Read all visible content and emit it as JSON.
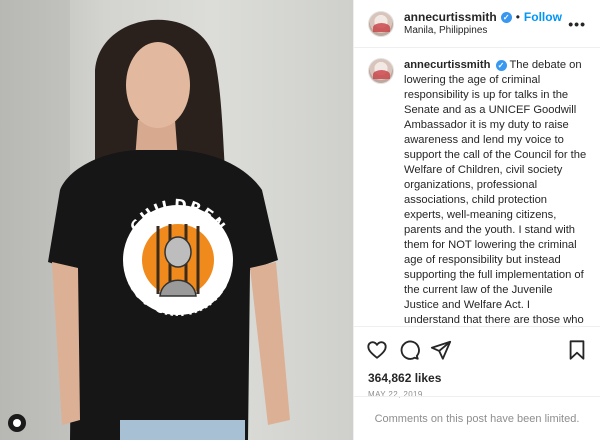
{
  "post": {
    "username": "annecurtissmith",
    "verified_symbol": "✓",
    "separator": "•",
    "follow_label": "Follow",
    "location": "Manila, Philippines",
    "more_symbol": "•••",
    "caption": "The debate on lowering the age of criminal responsibility is up for talks in the Senate and as a UNICEF Goodwill Ambassador it is my duty to raise awareness and lend my voice to support the call of the Council for the Welfare of Children, civil society organizations, professional associations, child protection experts, well-meaning citizens, parents and the youth. I stand with them for NOT lowering the criminal age of responsibility but instead supporting the full implementation of the current law of the Juvenile Justice and Welfare Act. I understand that there are those who see differently but if you could only try and discern that they are STILL CHILDREN, are victims of their",
    "likes": "364,862 likes",
    "date": "MAY 22, 2019",
    "comments_notice": "Comments on this post have been limited."
  },
  "photo": {
    "shirt_top_text": "CHILDREN",
    "shirt_bottom_text": "NOT CRIMINALS"
  },
  "icons": [
    "heart-icon",
    "comment-icon",
    "share-icon",
    "bookmark-icon",
    "more-icon",
    "verified-icon"
  ],
  "colors": {
    "accent": "#0095f6",
    "verified": "#3897f0",
    "text": "#262626",
    "muted": "#8e8e8e",
    "shirt": "#151515",
    "badge_orange": "#f08a1c"
  }
}
